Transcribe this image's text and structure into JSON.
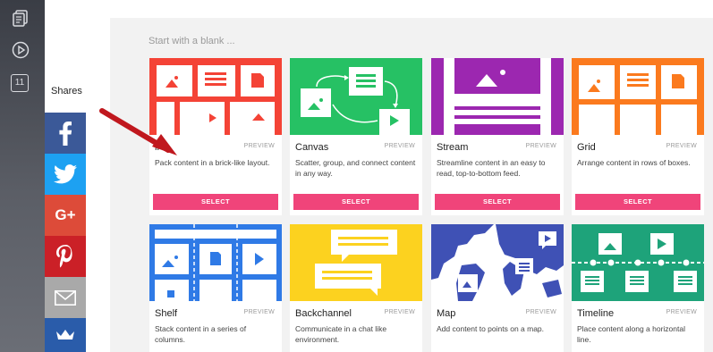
{
  "rail": {
    "icons": [
      "document-icon",
      "play-icon"
    ],
    "badge": "11"
  },
  "shares": {
    "label": "Shares",
    "buttons": [
      {
        "name": "facebook",
        "color": "#3b5998"
      },
      {
        "name": "twitter",
        "color": "#1da1f2"
      },
      {
        "name": "google-plus",
        "color": "#dd4b39"
      },
      {
        "name": "pinterest",
        "color": "#cb2027"
      },
      {
        "name": "email",
        "color": "#a9a9a9"
      },
      {
        "name": "crown",
        "color": "#2a5caa"
      }
    ],
    "google_plus_text": "G+"
  },
  "main": {
    "title": "Start with a blank ...",
    "preview_label": "PREVIEW",
    "select_label": "SELECT",
    "accent": "#f0447a",
    "cards": [
      {
        "name": "Brick",
        "visible_name": "ll",
        "desc": "Pack content in a brick-like layout.",
        "color": "#f44336"
      },
      {
        "name": "Canvas",
        "visible_name": "Canvas",
        "desc": "Scatter, group, and connect content in any way.",
        "color": "#26c164"
      },
      {
        "name": "Stream",
        "visible_name": "Stream",
        "desc": "Streamline content in an easy to read, top-to-bottom feed.",
        "color": "#9c27b0"
      },
      {
        "name": "Grid",
        "visible_name": "Grid",
        "desc": "Arrange content in rows of boxes.",
        "color": "#fb7a1e"
      },
      {
        "name": "Shelf",
        "visible_name": "Shelf",
        "desc": "Stack content in a series of columns.",
        "color": "#2f7ae6"
      },
      {
        "name": "Backchannel",
        "visible_name": "Backchannel",
        "desc": "Communicate in a chat like environment.",
        "color": "#fcd21f"
      },
      {
        "name": "Map",
        "visible_name": "Map",
        "desc": "Add content to points on a map.",
        "color": "#3f51b5"
      },
      {
        "name": "Timeline",
        "visible_name": "Timeline",
        "desc": "Place content along a horizontal line.",
        "color": "#1ea37a"
      }
    ]
  }
}
